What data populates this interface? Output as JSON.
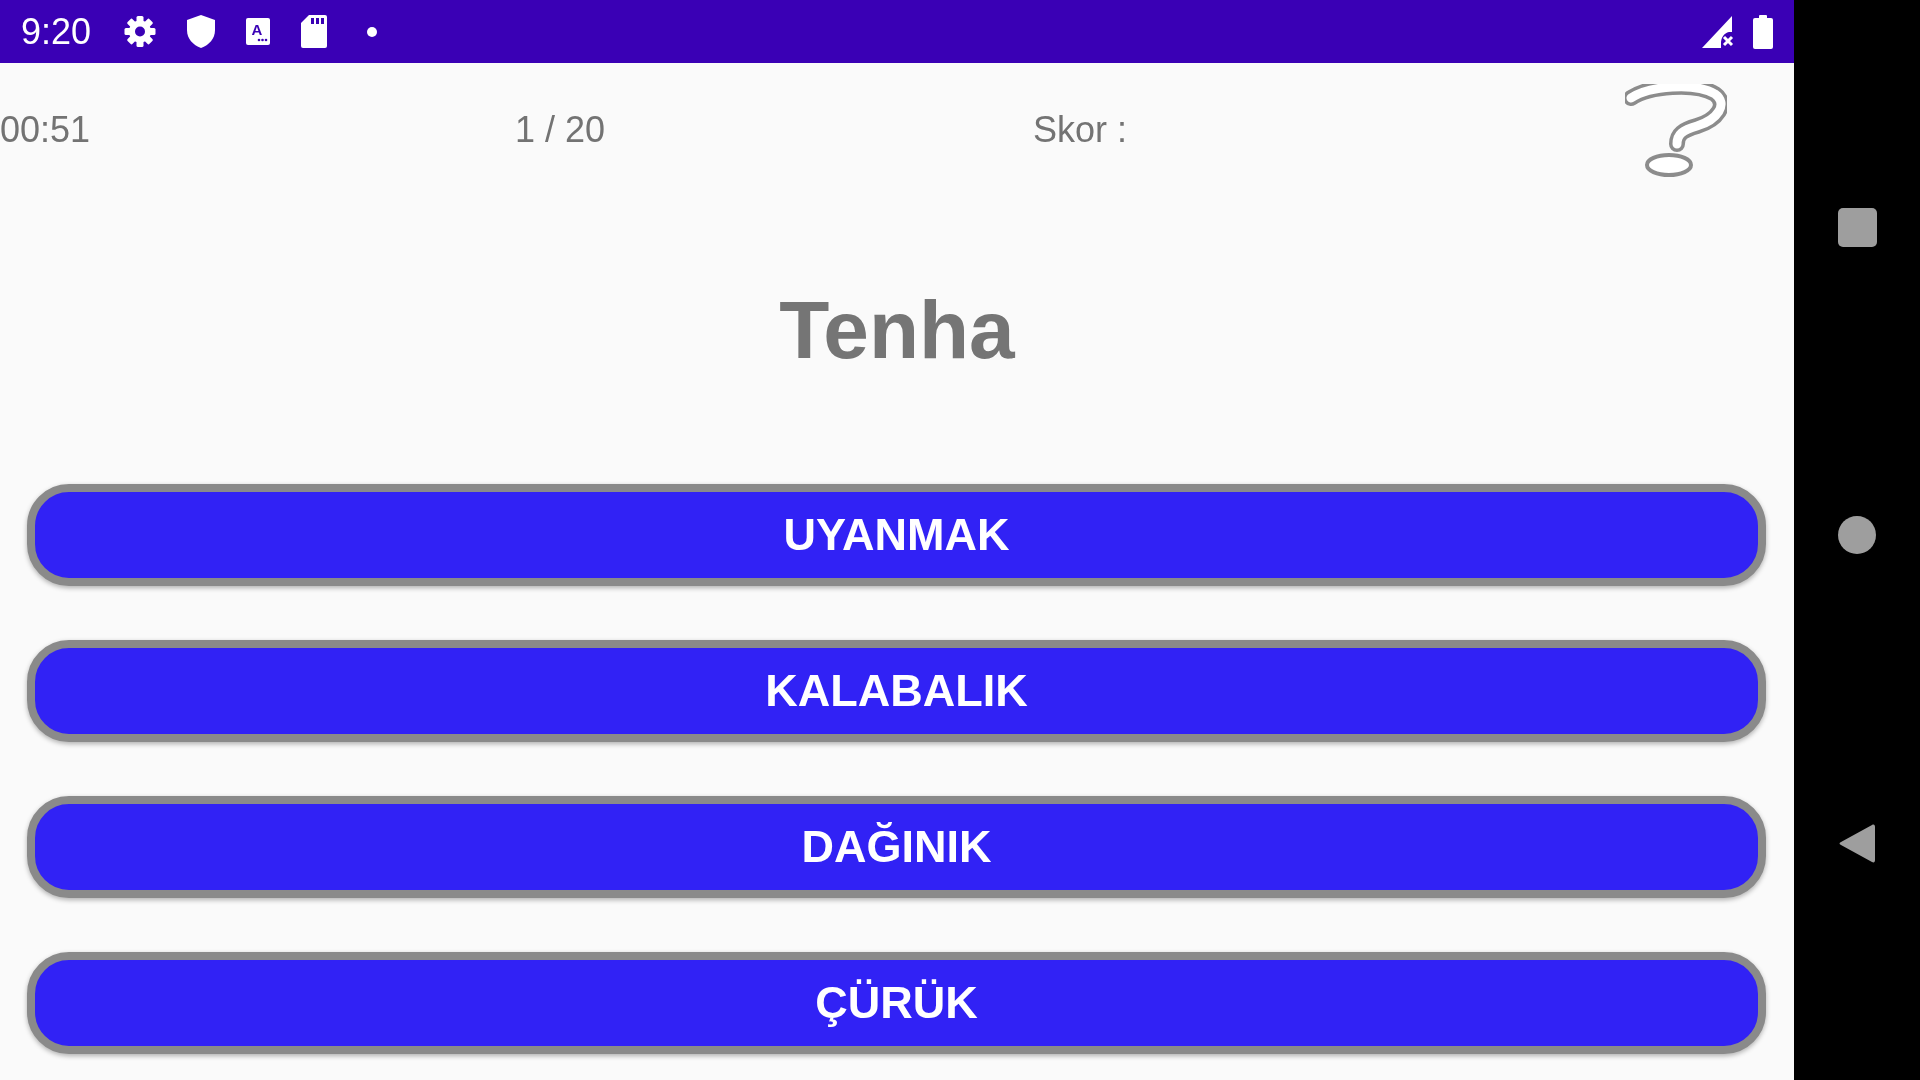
{
  "status_bar": {
    "time": "9:20",
    "tile_letter": "A"
  },
  "quiz_header": {
    "timer": "00:51",
    "progress": "1 / 20",
    "score_label": "Skor :"
  },
  "question_word": "Tenha",
  "answer_options": [
    "UYANMAK",
    "KALABALIK",
    "DAĞINIK",
    "ÇÜRÜK"
  ]
}
